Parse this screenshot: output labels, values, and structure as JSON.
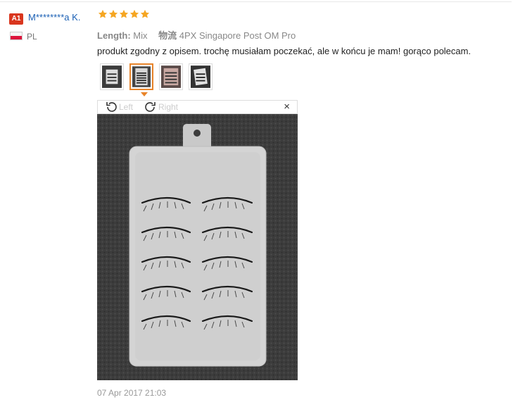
{
  "review": {
    "badge": "A1",
    "user": "M********a K.",
    "country": "PL",
    "rating": 5,
    "attributes": [
      {
        "key": "Length:",
        "value": "Mix"
      },
      {
        "key": "物流",
        "value": "4PX Singapore Post OM Pro"
      }
    ],
    "text": "produkt zgodny z opisem. trochę musiałam poczekać, ale w końcu je mam! gorąco polecam.",
    "date": "07 Apr 2017 21:03"
  },
  "viewer": {
    "rotate_left": "Left",
    "rotate_right": "Right",
    "close": "×",
    "selected_thumb": 2
  },
  "colors": {
    "star": "#f5a623",
    "accent": "#e8842a",
    "username": "#1a5fb4",
    "badge": "#d9361e"
  }
}
